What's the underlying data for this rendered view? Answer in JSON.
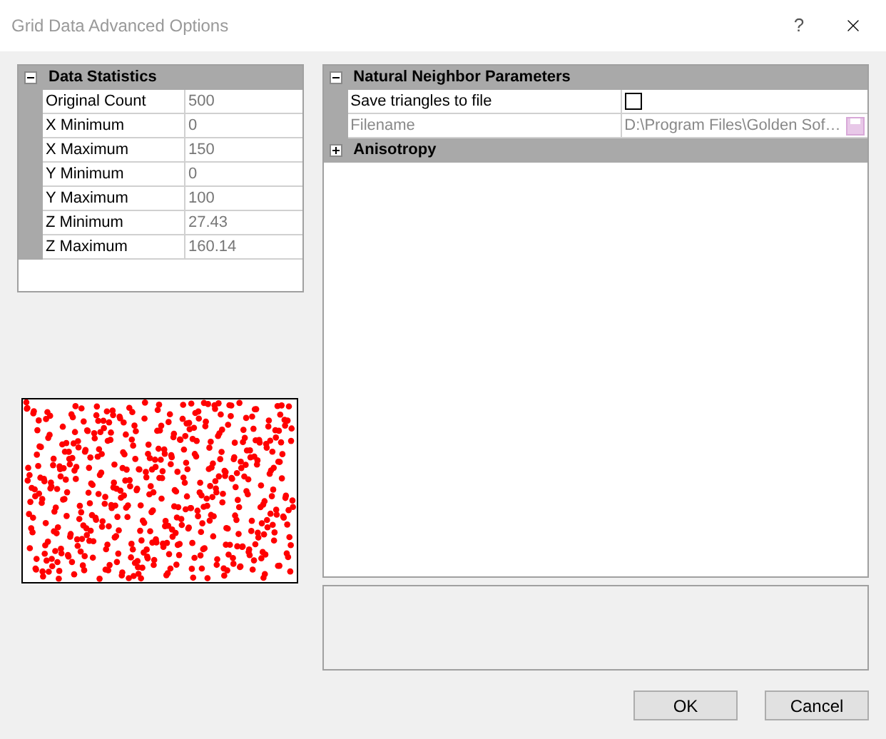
{
  "window": {
    "title": "Grid Data Advanced Options",
    "help": "?"
  },
  "data_statistics": {
    "title": "Data Statistics",
    "expanded": true,
    "rows": [
      {
        "name": "Original Count",
        "value": "500"
      },
      {
        "name": "X Minimum",
        "value": "0"
      },
      {
        "name": "X Maximum",
        "value": "150"
      },
      {
        "name": "Y Minimum",
        "value": "0"
      },
      {
        "name": "Y Maximum",
        "value": "100"
      },
      {
        "name": "Z Minimum",
        "value": "27.43"
      },
      {
        "name": "Z Maximum",
        "value": "160.14"
      }
    ]
  },
  "properties": [
    {
      "title": "Natural Neighbor Parameters",
      "expanded": true,
      "rows": [
        {
          "kind": "checkbox",
          "name": "Save triangles to file",
          "checked": false,
          "disabled": false
        },
        {
          "kind": "file",
          "name": "Filename",
          "value": "D:\\Program Files\\Golden Sof…",
          "disabled": true
        }
      ]
    },
    {
      "title": "Anisotropy",
      "expanded": false
    }
  ],
  "buttons": [
    "OK",
    "Cancel"
  ]
}
